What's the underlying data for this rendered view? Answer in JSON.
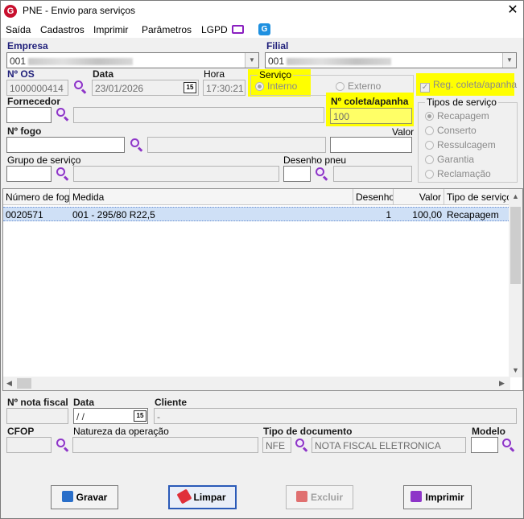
{
  "window": {
    "title": "PNE - Envio para serviços"
  },
  "menu": {
    "items": [
      "Saída",
      "Cadastros",
      "Imprimir",
      "Parâmetros",
      "LGPD"
    ]
  },
  "header": {
    "empresa_label": "Empresa",
    "empresa_value": "001",
    "filial_label": "Filial",
    "filial_value": "001",
    "os_label": "Nº OS",
    "os_value": "1000000414",
    "data_label": "Data",
    "data_value": "23/01/2026",
    "hora_label": "Hora",
    "hora_value": "17:30:21",
    "servico_title": "Serviço",
    "servico_interno": "Interno",
    "servico_externo": "Externo",
    "reg_coleta_label": "Reg. coleta/apanha",
    "fornecedor_label": "Fornecedor",
    "coleta_label": "Nº coleta/apanha",
    "coleta_value": "100",
    "fogo_label": "Nº fogo",
    "valor_label": "Valor",
    "grupo_label": "Grupo de serviço",
    "desenho_label": "Desenho pneu",
    "tipos_title": "Tipos de serviço",
    "tipos": [
      "Recapagem",
      "Conserto",
      "Ressulcagem",
      "Garantia",
      "Reclamação"
    ],
    "date_icon_text": "15"
  },
  "grid": {
    "columns": [
      "Número de fogo",
      "Medida",
      "Desenho",
      "Valor",
      "Tipo de serviço"
    ],
    "rows": [
      {
        "fogo": "0020571",
        "medida": "001 - 295/80 R22,5",
        "desenho": "1",
        "valor": "100,00",
        "tipo": "Recapagem"
      }
    ]
  },
  "footer": {
    "nota_label": "Nº nota fiscal",
    "data_label": "Data",
    "data_value": " /  /",
    "cliente_label": "Cliente",
    "cliente_value": "-",
    "cfop_label": "CFOP",
    "natureza_label": "Natureza da operação",
    "tipo_doc_label": "Tipo de documento",
    "tipo_doc_code": "NFE",
    "tipo_doc_desc": "NOTA FISCAL ELETRONICA",
    "modelo_label": "Modelo"
  },
  "buttons": {
    "gravar": "Gravar",
    "limpar": "Limpar",
    "excluir": "Excluir",
    "imprimir": "Imprimir"
  },
  "colors": {
    "highlight": "#ffff00",
    "label_blue": "#1f1f7a",
    "selection": "#cfe0f6",
    "search_icon": "#8e35c8"
  }
}
